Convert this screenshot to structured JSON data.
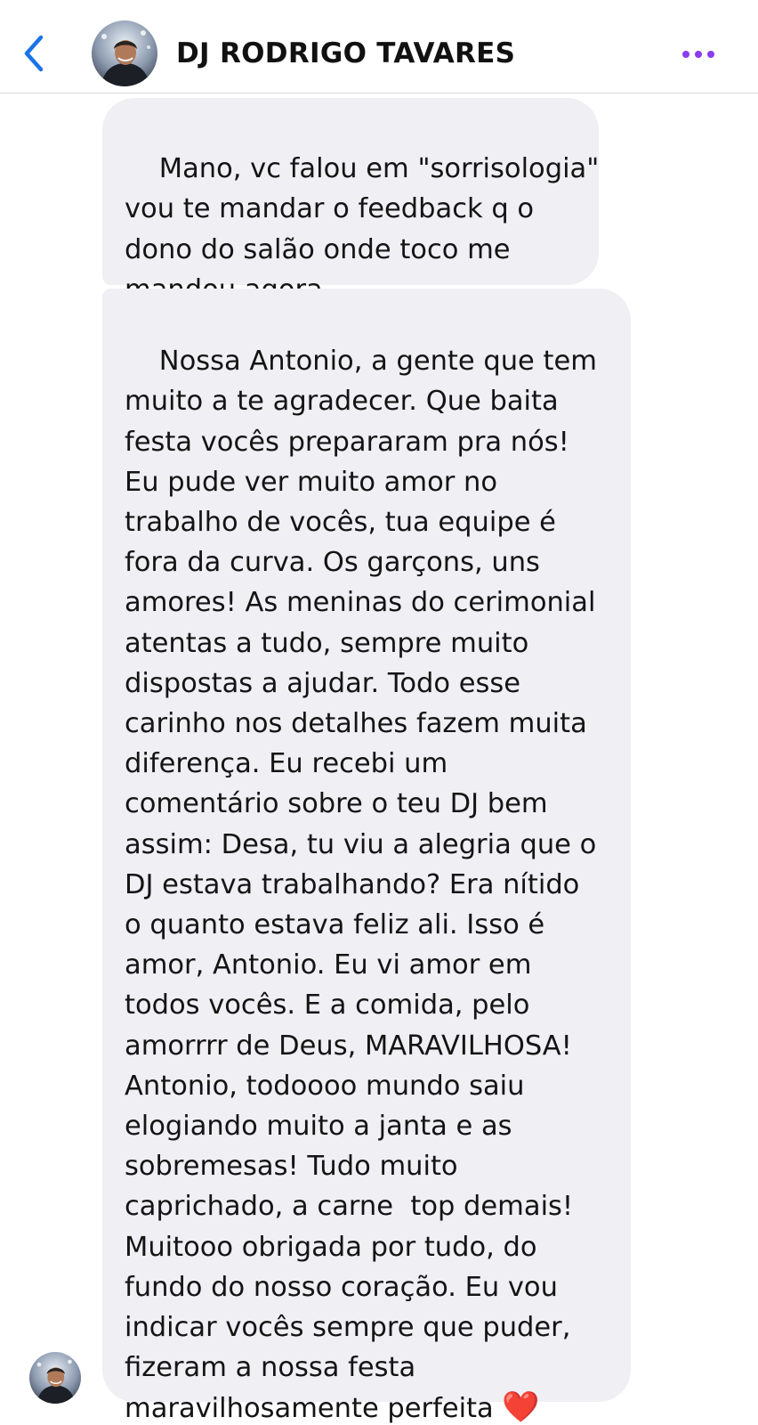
{
  "header": {
    "contact_name": "DJ RODRIGO TAVARES",
    "back_icon": "chevron-left-icon",
    "more_icon": "more-horizontal-icon",
    "accent_back": "#1a73e8",
    "accent_more": "#8a3cf0"
  },
  "messages": [
    {
      "text": "Mano, vc falou em \"sorrisologia\"\nvou te mandar o feedback q o\ndono do salão onde toco me\nmandou agora"
    },
    {
      "text": "Nossa Antonio, a gente que tem\nmuito a te agradecer. Que baita\nfesta vocês prepararam pra nós!\nEu pude ver muito amor no\ntrabalho de vocês, tua equipe é\nfora da curva. Os garçons, uns\namores! As meninas do cerimonial\natentas a tudo, sempre muito\ndispostas a ajudar. Todo esse\ncarinho nos detalhes fazem muita\ndiferença. Eu recebi um\ncomentário sobre o teu DJ bem\nassim: Desa, tu viu a alegria que o\nDJ estava trabalhando? Era nítido\no quanto estava feliz ali. Isso é\namor, Antonio. Eu vi amor em\ntodos vocês. E a comida, pelo\namorrrr de Deus, MARAVILHOSA!\nAntonio, todoooo mundo saiu\nelogiando muito a janta e as\nsobremesas! Tudo muito\ncaprichado, a carne  top demais!\nMuitooo obrigada por tudo, do\nfundo do nosso coração. Eu vou\nindicar vocês sempre que puder,\nfizeram a nossa festa\nmaravilhosamente perfeita ",
      "emoji": "❤️"
    }
  ],
  "colors": {
    "bubble_background": "#efeff4",
    "heart": "#e3262f"
  }
}
